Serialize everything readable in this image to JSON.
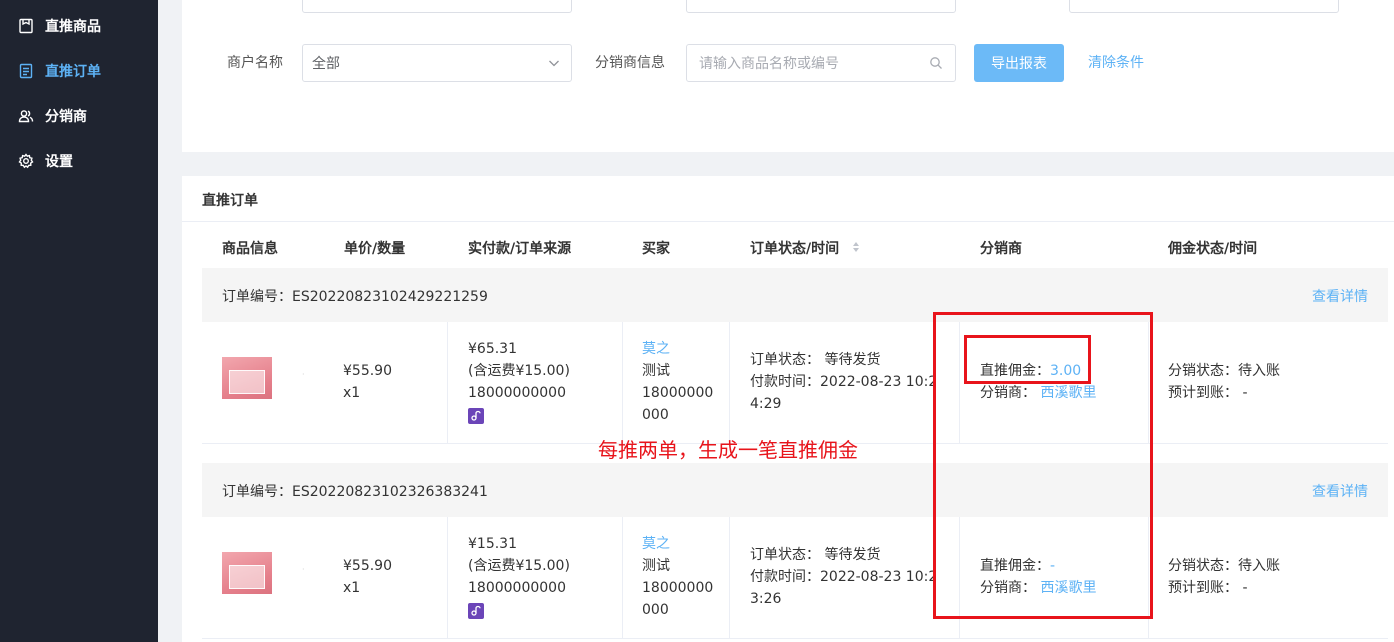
{
  "sidebar": {
    "items": [
      {
        "label": "直推商品",
        "icon": "box-icon",
        "active": false
      },
      {
        "label": "直推订单",
        "icon": "document-icon",
        "active": true
      },
      {
        "label": "分销商",
        "icon": "users-icon",
        "active": false
      },
      {
        "label": "设置",
        "icon": "gear-icon",
        "active": false
      }
    ]
  },
  "filters": {
    "merchant_label": "商户名称",
    "merchant_value": "全部",
    "distributor_label": "分销商信息",
    "distributor_placeholder": "请输入商品名称或编号",
    "export_label": "导出报表",
    "clear_label": "清除条件"
  },
  "orders_section": {
    "title": "直推订单",
    "columns": [
      "商品信息",
      "单价/数量",
      "实付款/订单来源",
      "买家",
      "订单状态/时间",
      "分销商",
      "佣金状态/时间"
    ],
    "detail_link": "查看详情",
    "orders": [
      {
        "order_no": "订单编号：ES20220823102429221259",
        "price": "¥55.90",
        "qty": "x1",
        "paid": "¥65.31",
        "shipping": "(含运费¥15.00)",
        "source_phone": "18000000000",
        "buyer_name": "莫之",
        "buyer_note": "测试",
        "buyer_phone_1": "18000000",
        "buyer_phone_2": "000",
        "status": "订单状态： 等待发货",
        "pay_time_1": "付款时间：2022-08-23 10:2",
        "pay_time_2": "4:29",
        "commission_label": "直推佣金：",
        "commission_value": "3.00",
        "distributor_label": "分销商：",
        "distributor_value": "西溪歌里",
        "commission_status": "分销状态：待入账",
        "expected_arrival": "预计到账：  -"
      },
      {
        "order_no": "订单编号：ES20220823102326383241",
        "price": "¥55.90",
        "qty": "x1",
        "paid": "¥15.31",
        "shipping": "(含运费¥15.00)",
        "source_phone": "18000000000",
        "buyer_name": "莫之",
        "buyer_note": "测试",
        "buyer_phone_1": "18000000",
        "buyer_phone_2": "000",
        "status": "订单状态： 等待发货",
        "pay_time_1": "付款时间：2022-08-23 10:2",
        "pay_time_2": "3:26",
        "commission_label": "直推佣金：",
        "commission_value": "-",
        "distributor_label": "分销商：",
        "distributor_value": "西溪歌里",
        "commission_status": "分销状态：待入账",
        "expected_arrival": "预计到账：  -"
      }
    ]
  },
  "annotation": {
    "text": "每推两单，生成一笔直推佣金",
    "color": "#e8141b"
  },
  "colors": {
    "sidebar_bg": "#1f2430",
    "accent": "#5db2f5",
    "export_button": "#6cbaf7"
  }
}
